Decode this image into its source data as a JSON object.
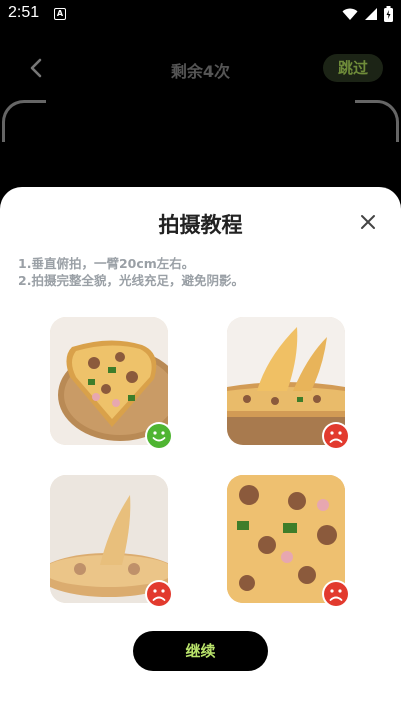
{
  "status": {
    "time": "2:51",
    "notification_letter": "A"
  },
  "header": {
    "title": "剩余4次",
    "skip_label": "跳过"
  },
  "sheet": {
    "title": "拍摄教程",
    "instructions": [
      "1.垂直俯拍，一臂20cm左右。",
      "2.拍摄完整全貌，光线充足，避免阴影。"
    ],
    "continue_label": "继续"
  },
  "examples": [
    {
      "name": "heart-pizza-top-view",
      "status": "good",
      "badge_icon": "smile-icon",
      "badge_color": "#4fb532"
    },
    {
      "name": "pizza-cheese-pull-angled",
      "status": "bad",
      "badge_icon": "frown-icon",
      "badge_color": "#e23a2e"
    },
    {
      "name": "pizza-blurry",
      "status": "bad",
      "badge_icon": "frown-icon",
      "badge_color": "#e23a2e"
    },
    {
      "name": "pizza-cropped-closeup",
      "status": "bad",
      "badge_icon": "frown-icon",
      "badge_color": "#e23a2e"
    }
  ],
  "colors": {
    "accent": "#b9e36b",
    "skip_bg": "#1c2416",
    "skip_text": "#6f8c3a"
  }
}
